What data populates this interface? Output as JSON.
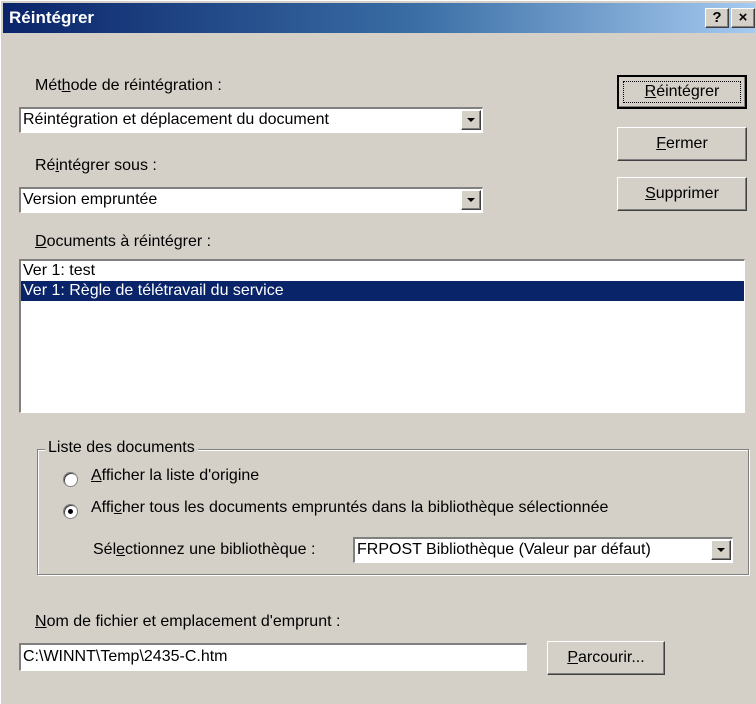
{
  "window": {
    "title": "Réintégrer",
    "help_button": "?",
    "close_button": "×"
  },
  "method": {
    "label_pre": "Mét",
    "label_key": "h",
    "label_post": "ode de réintégration :",
    "value": "Réintégration et déplacement du document"
  },
  "reintegrate_as": {
    "label_pre": "Ré",
    "label_key": "i",
    "label_post": "ntégrer sous :",
    "value": "Version empruntée"
  },
  "buttons": {
    "reintegrate_key": "R",
    "reintegrate_rest": "éintégrer",
    "close_key": "F",
    "close_rest": "ermer",
    "delete_key": "S",
    "delete_rest": "upprimer",
    "browse_key": "P",
    "browse_rest": "arcourir..."
  },
  "documents": {
    "label_key": "D",
    "label_rest": "ocuments à réintégrer :",
    "items": [
      {
        "text": "Ver  1: test",
        "selected": false
      },
      {
        "text": "Ver  1: Règle de télétravail du service",
        "selected": true
      }
    ]
  },
  "list_group": {
    "legend": "Liste des documents",
    "option1_key": "A",
    "option1_rest": "fficher la liste d'origine",
    "option2_pre": "Affi",
    "option2_key": "c",
    "option2_post": "her tous les documents empruntés dans la bibliothèque sélectionnée",
    "selected_option": 2,
    "library_label_pre": "Sél",
    "library_label_key": "e",
    "library_label_post": "ctionnez une bibliothèque :",
    "library_value": "FRPOST Bibliothèque  (Valeur par défaut)"
  },
  "file": {
    "label_key": "N",
    "label_rest": "om de fichier et emplacement d'emprunt :",
    "value": "C:\\WINNT\\Temp\\2435-C.htm"
  }
}
